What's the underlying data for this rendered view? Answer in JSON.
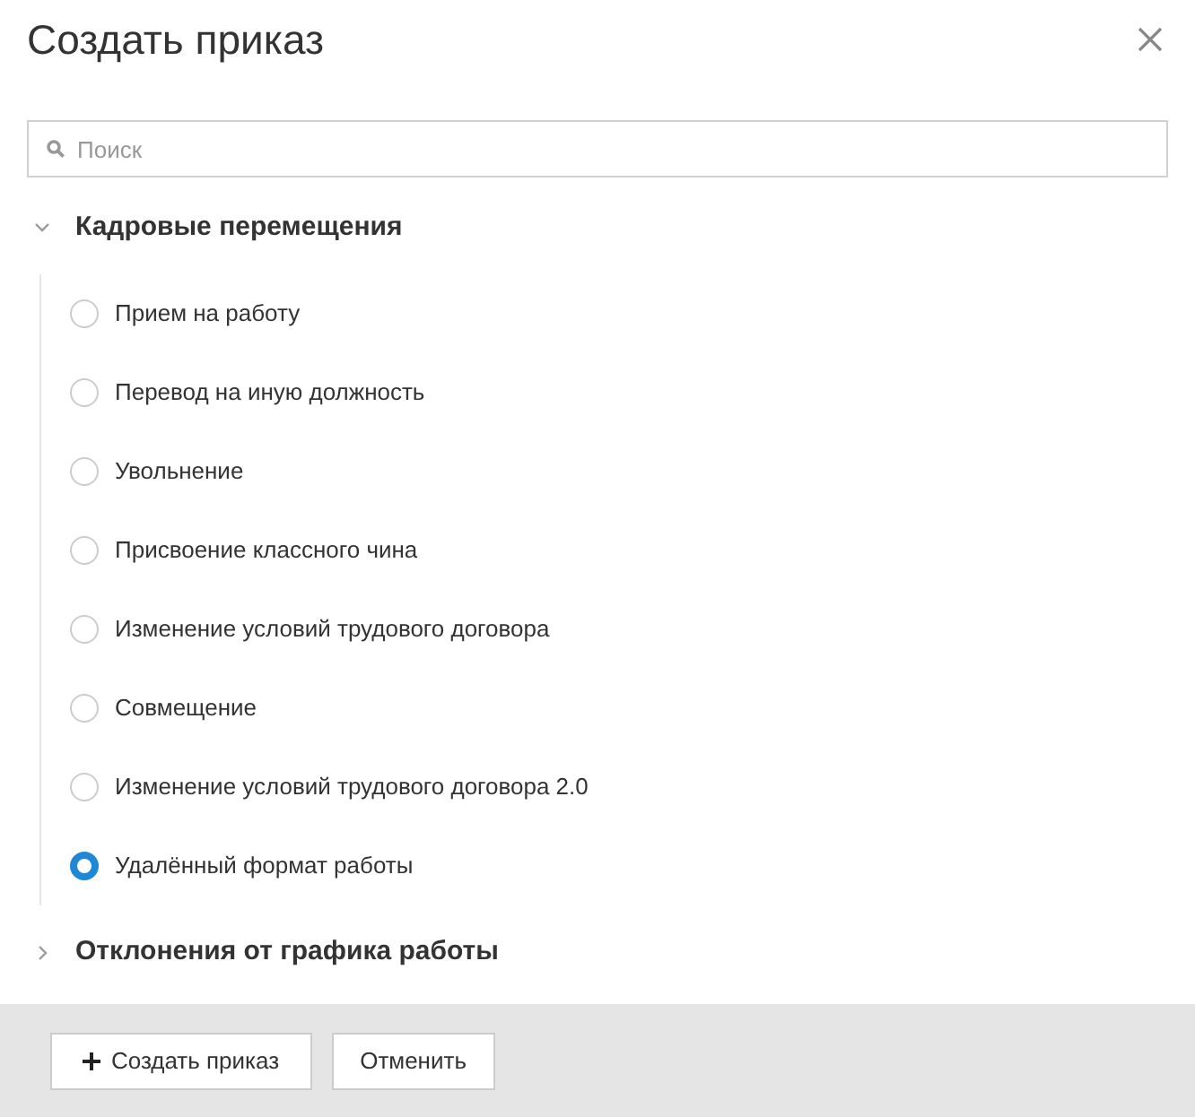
{
  "dialog": {
    "title": "Создать приказ"
  },
  "search": {
    "placeholder": "Поиск"
  },
  "groups": [
    {
      "label": "Кадровые перемещения",
      "expanded": true,
      "children": [
        {
          "label": "Прием на работу",
          "selected": false
        },
        {
          "label": "Перевод на иную должность",
          "selected": false
        },
        {
          "label": "Увольнение",
          "selected": false
        },
        {
          "label": "Присвоение классного чина",
          "selected": false
        },
        {
          "label": "Изменение условий трудового договора",
          "selected": false
        },
        {
          "label": "Совмещение",
          "selected": false
        },
        {
          "label": "Изменение условий трудового договора 2.0",
          "selected": false
        },
        {
          "label": "Удалённый формат работы",
          "selected": true
        }
      ]
    },
    {
      "label": "Отклонения от графика работы",
      "expanded": false
    }
  ],
  "buttons": [
    {
      "label": "Создать приказ",
      "kind": "create"
    },
    {
      "label": "Отменить",
      "kind": "cancel"
    }
  ]
}
